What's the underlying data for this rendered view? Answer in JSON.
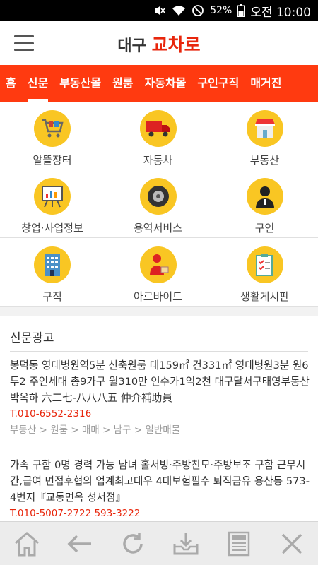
{
  "status_bar": {
    "battery": "52%",
    "time": "오전 10:00"
  },
  "header": {
    "title_part1": "대구",
    "title_part2": "교차로"
  },
  "tabs": [
    "홈",
    "신문",
    "부동산몰",
    "원룸",
    "자동차몰",
    "구인구직",
    "매거진"
  ],
  "active_tab_index": 1,
  "categories": [
    {
      "label": "알뜰장터",
      "icon": "shopping-cart"
    },
    {
      "label": "자동차",
      "icon": "truck"
    },
    {
      "label": "부동산",
      "icon": "store"
    },
    {
      "label": "창업·사업정보",
      "icon": "presentation"
    },
    {
      "label": "용역서비스",
      "icon": "tire"
    },
    {
      "label": "구인",
      "icon": "person"
    },
    {
      "label": "구직",
      "icon": "building"
    },
    {
      "label": "아르바이트",
      "icon": "delivery-worker"
    },
    {
      "label": "생활게시판",
      "icon": "checklist"
    }
  ],
  "section": {
    "title": "신문광고",
    "items": [
      {
        "text": "봉덕동 영대병원역5분 신축원룸 대159㎡ 건331㎡ 영대병원3분 원6 투2 주인세대 총9가구 월310만 인수가1억2천 대구달서구태영부동산 박옥하 六二七-八八八五 仲介補助員",
        "phone": "T.010-6552-2316",
        "crumbs": "부동산 > 원룸 > 매매 > 남구 > 일반매물"
      },
      {
        "text": "가족 구함 0명 경력 가능 남녀 홀서빙·주방찬모·주방보조 구함 근무시간,급여 면접후협의 업계최고대우 4대보험필수 퇴직금유 용산동 573-4번지『교동면옥 성서점』",
        "phone": "T.010-5007-2722 593-3222",
        "crumbs": ""
      }
    ]
  },
  "bottom_nav": [
    "home",
    "back",
    "refresh",
    "download",
    "news",
    "close"
  ]
}
